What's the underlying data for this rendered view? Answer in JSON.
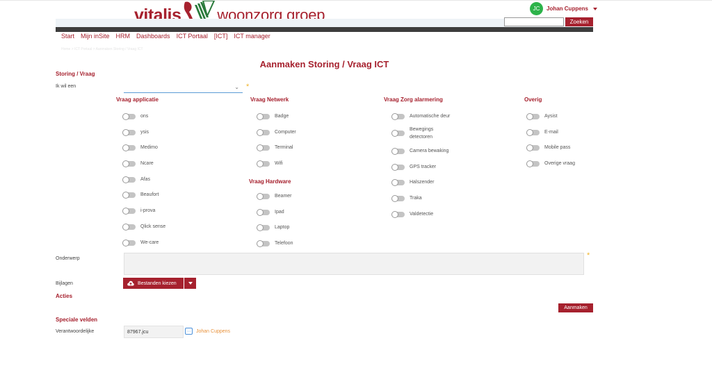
{
  "logo": {
    "part1": "vitalis",
    "part2": "woonzorg groep"
  },
  "user": {
    "initials": "JC",
    "name": "Johan Cuppens"
  },
  "search": {
    "value": "",
    "button_label": "Zoeken"
  },
  "nav": {
    "items": [
      "Start",
      "Mijn inSite",
      "HRM",
      "Dashboards",
      "ICT Portaal",
      "[ICT]",
      "ICT manager"
    ]
  },
  "breadcrumb": "Home > ICT Portaal > Aanmaken Storing / Vraag ICT",
  "page": {
    "title": "Aanmaken Storing / Vraag ICT"
  },
  "form": {
    "section_storing": "Storing / Vraag",
    "ik_wil_een_label": "Ik wil een",
    "ik_wil_een_value": "",
    "required_mark": "*",
    "columns": {
      "applicatie": {
        "title": "Vraag applicatie",
        "items": [
          "ons",
          "ysis",
          "Medimo",
          "Ncare",
          "Afas",
          "Beaufort",
          "i-prova",
          "Qlick sense",
          "We-care"
        ]
      },
      "netwerk": {
        "title": "Vraag Netwerk",
        "items": [
          "Badge",
          "Computer",
          "Terminal",
          "Wifi"
        ]
      },
      "hardware": {
        "title": "Vraag Hardware",
        "items": [
          "Beamer",
          "Ipad",
          "Laptop",
          "Telefoon"
        ]
      },
      "zorg": {
        "title": "Vraag Zorg alarmering",
        "items": [
          "Automatische deur",
          "Bewegings detectoren",
          "Camera bewaking",
          "GPS tracker",
          "Halszender",
          "Traka",
          "Valdetectie"
        ]
      },
      "overig": {
        "title": "Overig",
        "items": [
          "Aysist",
          "E-mail",
          "Mobile pass",
          "Overige vraag"
        ]
      }
    },
    "onderwerp_label": "Onderwerp",
    "onderwerp_value": "",
    "bijlagen_label": "Bijlagen",
    "upload_button": "Bestanden kiezen",
    "acties_title": "Acties",
    "create_button": "Aanmaken",
    "speciale_velden_title": "Speciale velden",
    "verantwoordelijke_label": "Verantwoordelijke",
    "verantwoordelijke_value": "87967.jcu",
    "verantwoordelijke_name": "Johan Cuppens",
    "dots_button": "···"
  }
}
